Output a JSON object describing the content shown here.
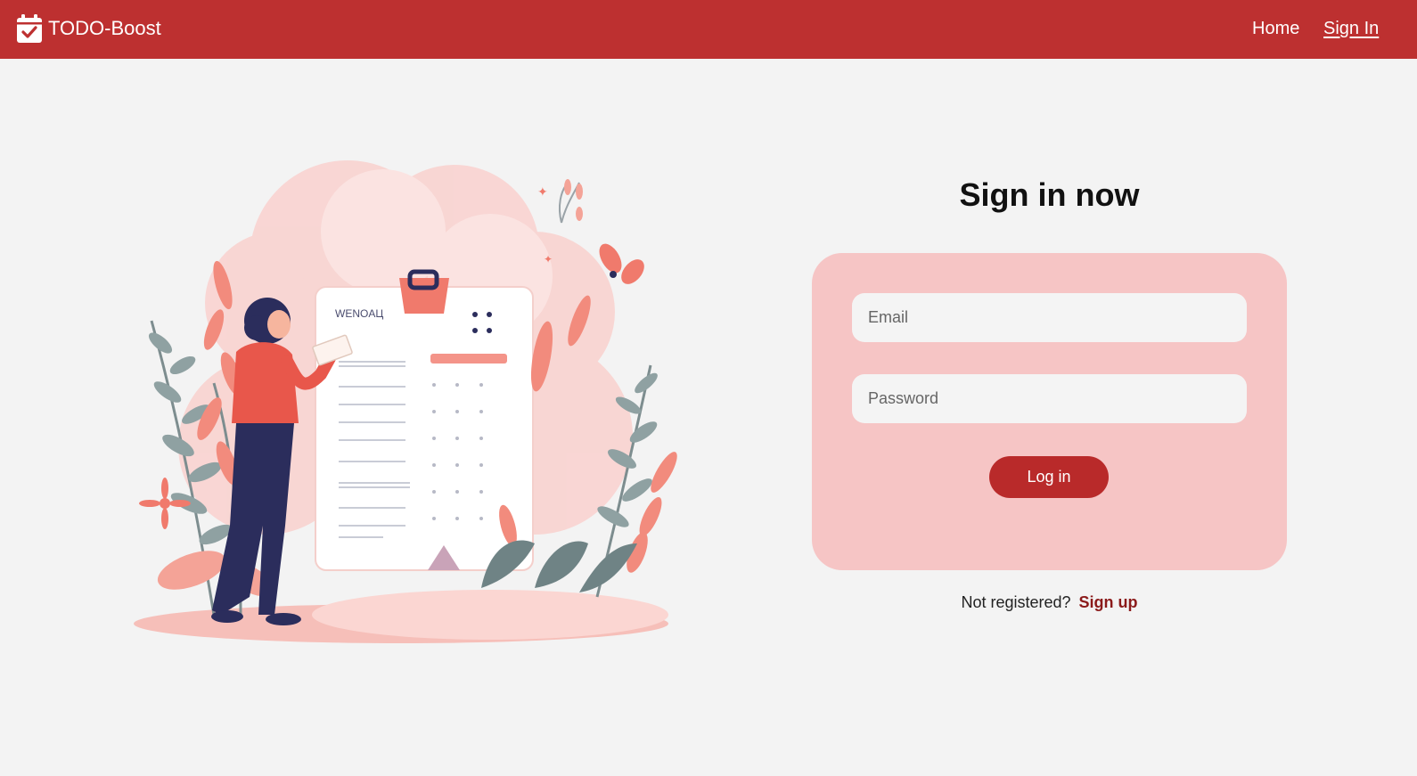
{
  "app": {
    "name": "TODO-Boost"
  },
  "nav": {
    "home_label": "Home",
    "signin_label": "Sign In"
  },
  "illustration": {
    "board_label": "WENOAЦ"
  },
  "login": {
    "title": "Sign in now",
    "email_placeholder": "Email",
    "password_placeholder": "Password",
    "button_label": "Log in"
  },
  "footer": {
    "prompt": "Not registered?",
    "signup_label": "Sign up"
  },
  "colors": {
    "brand": "#bd3030",
    "card": "#f6c5c5",
    "button": "#b92a2a",
    "link": "#8b1a1a",
    "background": "#f3f3f3"
  }
}
